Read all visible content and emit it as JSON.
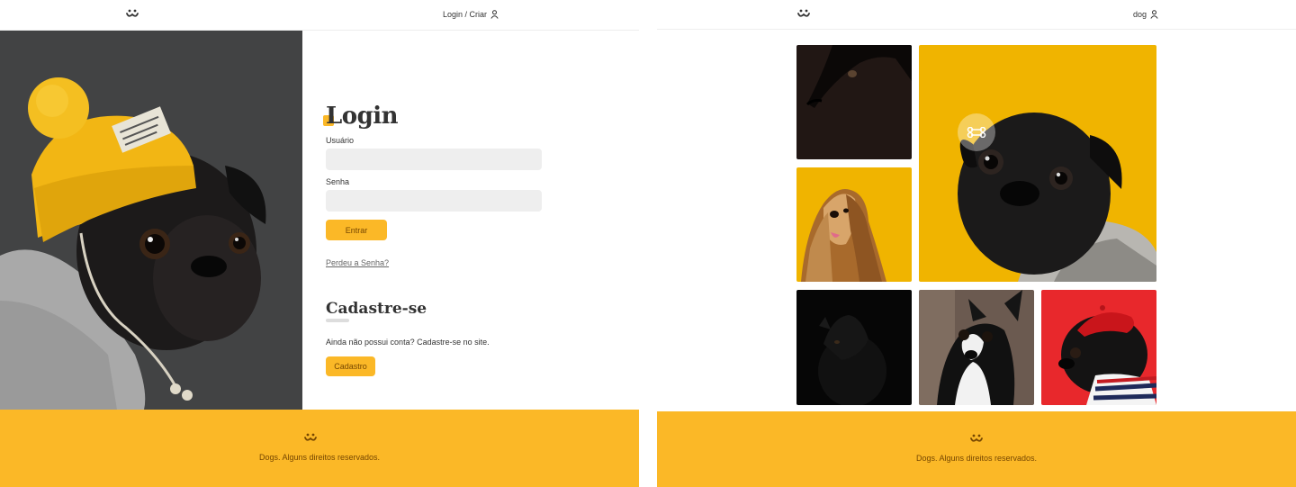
{
  "left_screen": {
    "header": {
      "logo": "dog-face-logo",
      "user_link": "Login / Criar",
      "user_icon": "user-icon"
    },
    "login": {
      "title": "Login",
      "username_label": "Usuário",
      "username_value": "",
      "password_label": "Senha",
      "password_value": "",
      "submit_label": "Entrar",
      "lost_password_link": "Perdeu a Senha?"
    },
    "register": {
      "title": "Cadastre-se",
      "text": "Ainda não possui conta? Cadastre-se no site.",
      "button_label": "Cadastro"
    },
    "footer": {
      "logo": "dog-face-logo",
      "text": "Dogs. Alguns direitos reservados."
    }
  },
  "right_screen": {
    "header": {
      "logo": "dog-face-logo",
      "user_link": "dog",
      "user_icon": "user-icon"
    },
    "feed": {
      "photos": [
        {
          "subject": "black dog in shadow",
          "background": "#211714"
        },
        {
          "subject": "black pug in sweater",
          "background": "#f0b400",
          "views_icon": "bone-icon"
        },
        {
          "subject": "afghan hound",
          "background": "#f0b400"
        },
        {
          "subject": "black dog looking up",
          "background": "#060606"
        },
        {
          "subject": "boston terrier",
          "background": "#6b5a50"
        },
        {
          "subject": "pug with red beret",
          "background": "#e8282c"
        }
      ]
    },
    "footer": {
      "logo": "dog-face-logo",
      "text": "Dogs. Alguns direitos reservados."
    }
  },
  "colors": {
    "accent": "#fbb827",
    "accent_text": "#764701",
    "input_bg": "#eeeeee",
    "text": "#333333"
  }
}
